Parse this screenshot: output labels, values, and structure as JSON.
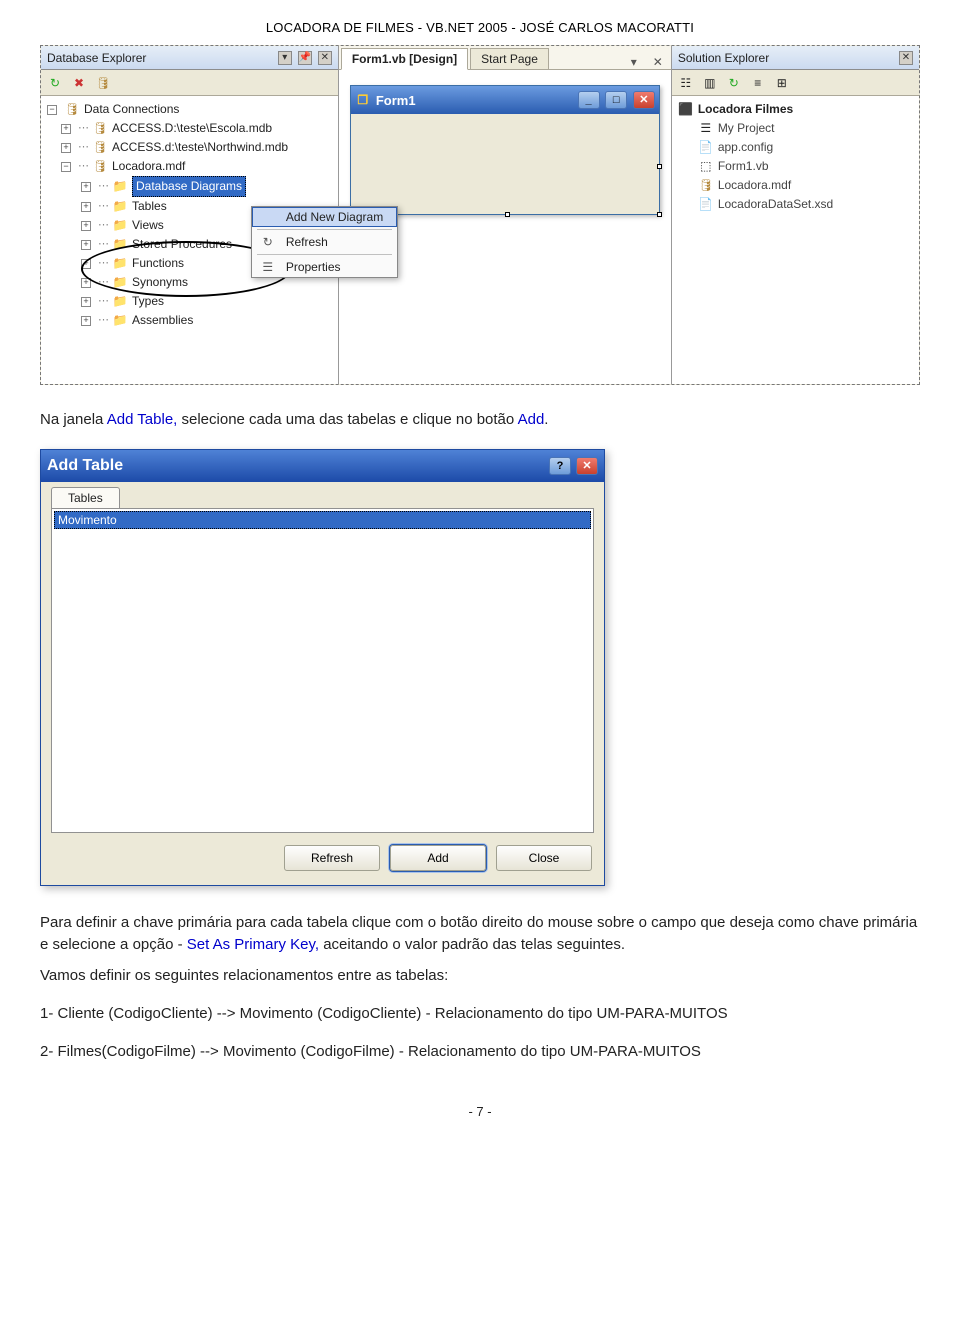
{
  "doc": {
    "header": "LOCADORA DE FILMES  - VB.NET 2005 - JOSÉ CARLOS MACORATTI",
    "page_number": "- 7 -"
  },
  "dbexplorer": {
    "title": "Database Explorer",
    "root": "Data Connections",
    "nodes": {
      "conn1": "ACCESS.D:\\teste\\Escola.mdb",
      "conn2": "ACCESS.d:\\teste\\Northwind.mdb",
      "conn3": "Locadora.mdf",
      "dbdiag": "Database Diagrams",
      "tables": "Tables",
      "views": "Views",
      "sprocs": "Stored Procedures",
      "functions": "Functions",
      "synonyms": "Synonyms",
      "types": "Types",
      "assemblies": "Assemblies"
    }
  },
  "tabs": {
    "form": "Form1.vb [Design]",
    "start": "Start Page"
  },
  "childform": {
    "title": "Form1"
  },
  "contextmenu": {
    "addnew": "Add New Diagram",
    "refresh": "Refresh",
    "props": "Properties"
  },
  "solx": {
    "title": "Solution Explorer",
    "root": "Locadora Filmes",
    "items": {
      "myproj": "My Project",
      "appconfig": "app.config",
      "form1vb": "Form1.vb",
      "mdf": "Locadora.mdf",
      "xsd": "LocadoraDataSet.xsd"
    }
  },
  "body": {
    "p1_a": "Na janela ",
    "p1_b": "Add Table,",
    "p1_c": " selecione cada uma das tabelas e clique no botão ",
    "p1_d": "Add",
    "p1_e": ".",
    "p2_a": "Para definir a chave primária para cada tabela clique com o botão direito do mouse sobre o campo que deseja como chave primária e selecione a opção - ",
    "p2_b": "Set As Primary Key,",
    "p2_c": " aceitando o valor padrão das telas seguintes.",
    "p3": "Vamos definir os seguintes relacionamentos entre as tabelas:",
    "rel1": "1- Cliente (CodigoCliente) -->    Movimento (CodigoCliente)  - Relacionamento do tipo UM-PARA-MUITOS",
    "rel2": "2- Filmes(CodigoFilme) -->  Movimento (CodigoFilme)  -  Relacionamento do tipo UM-PARA-MUITOS"
  },
  "dlg": {
    "title": "Add Table",
    "tab": "Tables",
    "item": "Movimento",
    "btn_refresh": "Refresh",
    "btn_add": "Add",
    "btn_close": "Close"
  }
}
